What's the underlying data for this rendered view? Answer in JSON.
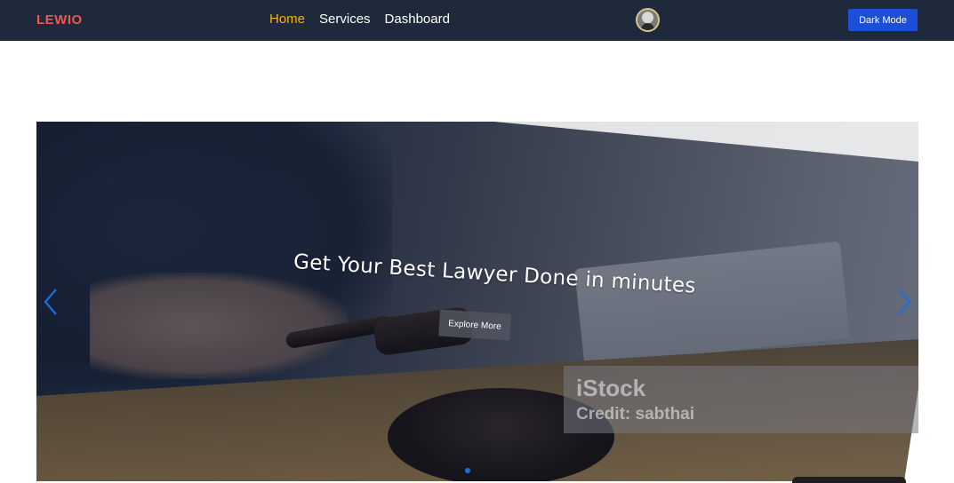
{
  "navbar": {
    "brand": "LEWIO",
    "links": [
      {
        "label": "Home",
        "active": true
      },
      {
        "label": "Services",
        "active": false
      },
      {
        "label": "Dashboard",
        "active": false
      }
    ],
    "avatar_icon": "user-avatar",
    "dark_mode_label": "Dark Mode"
  },
  "carousel": {
    "headline": "Get Your Best Lawyer Done in minutes",
    "cta_label": "Explore More",
    "watermark": {
      "brand": "iStock",
      "credit": "Credit: sabthai"
    },
    "prev_icon": "chevron-left-icon",
    "next_icon": "chevron-right-icon",
    "active_slide_index": 0,
    "slide_count": 1
  },
  "colors": {
    "navbar_bg": "#1e293b",
    "brand": "#f0584f",
    "active_link": "#f5b400",
    "button_blue": "#1d4ed8",
    "arrow_blue": "#1d6fe0"
  }
}
